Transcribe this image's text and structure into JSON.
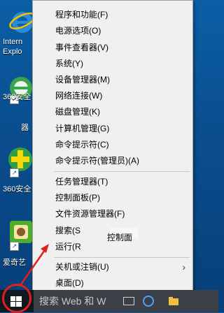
{
  "desktop": {
    "icons": [
      {
        "label_lines": [
          "Intern",
          "Explo"
        ],
        "name": "ie"
      },
      {
        "label_lines": [
          "360安全",
          "器"
        ],
        "name": "360-browser"
      },
      {
        "label_lines": [
          "360安全"
        ],
        "name": "360-guard"
      },
      {
        "label_lines": [
          "爱奇艺"
        ],
        "name": "iqiyi"
      }
    ]
  },
  "menu": {
    "items": [
      {
        "label": "程序和功能(F)"
      },
      {
        "label": "电源选项(O)"
      },
      {
        "label": "事件查看器(V)"
      },
      {
        "label": "系统(Y)"
      },
      {
        "label": "设备管理器(M)"
      },
      {
        "label": "网络连接(W)"
      },
      {
        "label": "磁盘管理(K)"
      },
      {
        "label": "计算机管理(G)"
      },
      {
        "label": "命令提示符(C)"
      },
      {
        "label": "命令提示符(管理员)(A)"
      },
      {
        "label": "任务管理器(T)"
      },
      {
        "label": "控制面板(P)"
      },
      {
        "label": "文件资源管理器(F)"
      },
      {
        "label": "搜索(S"
      },
      {
        "label": "运行(R"
      },
      {
        "label": "关机或注销(U)"
      },
      {
        "label": "桌面(D)"
      }
    ],
    "obscured_text": "控制面"
  },
  "taskbar": {
    "search_placeholder": "搜索 Web 和 W"
  },
  "colors": {
    "annotation": "#e0201c",
    "menu_bg": "#f0f0f0",
    "taskbar_bg": "#101820"
  }
}
